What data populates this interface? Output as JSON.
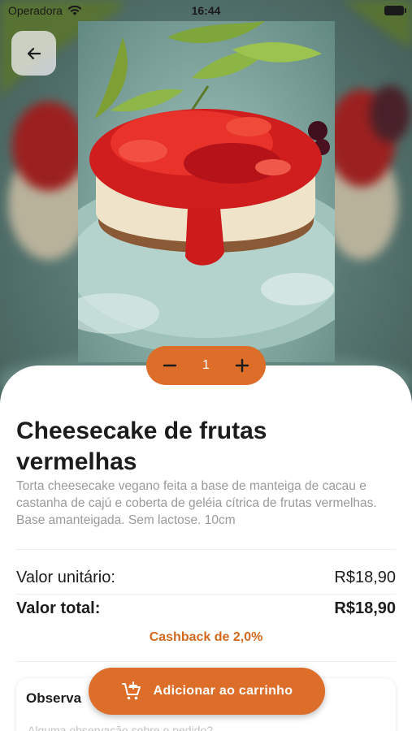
{
  "status_bar": {
    "carrier": "Operadora",
    "time": "16:44"
  },
  "product": {
    "title": "Cheesecake de frutas vermelhas",
    "description": "Torta cheesecake vegano feita a base de manteiga de cacau e castanha de cajú e coberta de geléia cítrica de frutas vermelhas. Base amanteigada. Sem lactose. 10cm"
  },
  "quantity": {
    "value": "1"
  },
  "pricing": {
    "unit_label": "Valor unitário:",
    "unit_value": "R$18,90",
    "total_label": "Valor total:",
    "total_value": "R$18,90",
    "cashback": "Cashback de 2,0%"
  },
  "notes": {
    "title": "Observa",
    "placeholder": "Alguma observação sobre o pedido?"
  },
  "cart_button": {
    "label": "Adicionar ao carrinho"
  },
  "colors": {
    "accent": "#dc6e2a",
    "cashback": "#d2691e"
  },
  "icons": {
    "back": "arrow-left-icon",
    "minus": "minus-icon",
    "plus": "plus-icon",
    "cart": "cart-add-icon",
    "wifi": "wifi-icon",
    "battery": "battery-icon"
  }
}
